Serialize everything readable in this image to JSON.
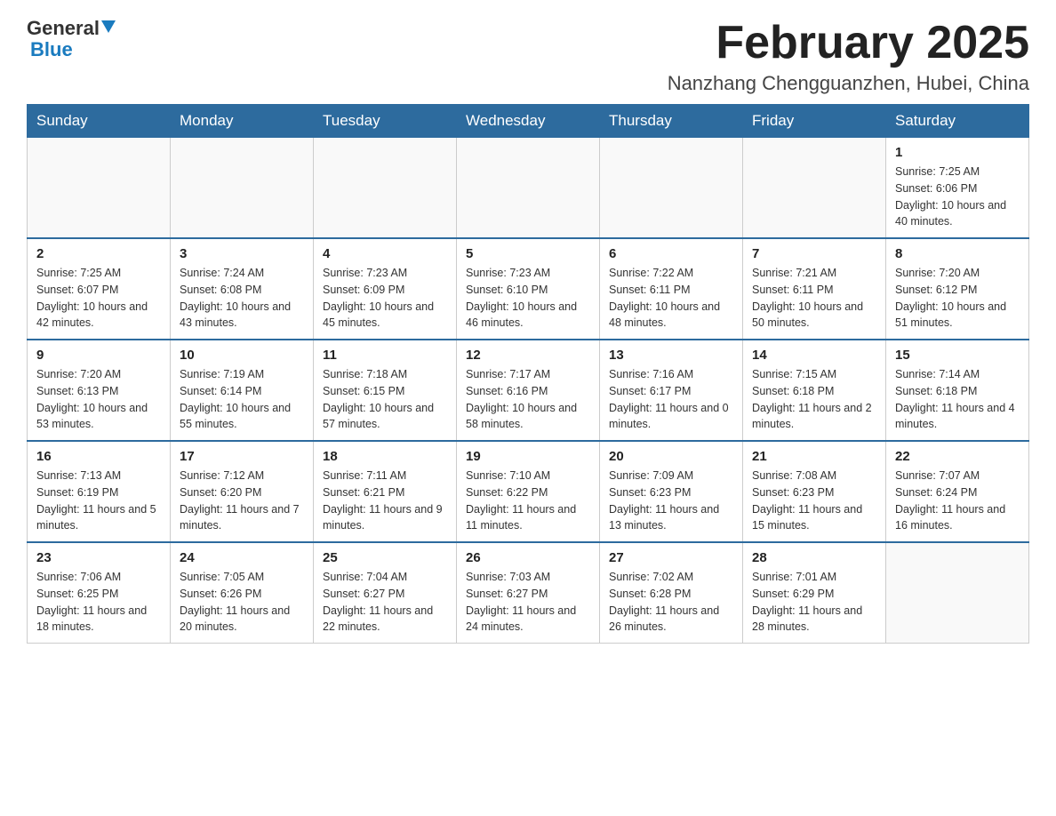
{
  "logo": {
    "part1": "General",
    "part2": "Blue"
  },
  "header": {
    "title": "February 2025",
    "subtitle": "Nanzhang Chengguanzhen, Hubei, China"
  },
  "days_of_week": [
    "Sunday",
    "Monday",
    "Tuesday",
    "Wednesday",
    "Thursday",
    "Friday",
    "Saturday"
  ],
  "weeks": [
    {
      "days": [
        {
          "num": "",
          "info": ""
        },
        {
          "num": "",
          "info": ""
        },
        {
          "num": "",
          "info": ""
        },
        {
          "num": "",
          "info": ""
        },
        {
          "num": "",
          "info": ""
        },
        {
          "num": "",
          "info": ""
        },
        {
          "num": "1",
          "info": "Sunrise: 7:25 AM\nSunset: 6:06 PM\nDaylight: 10 hours and 40 minutes."
        }
      ]
    },
    {
      "days": [
        {
          "num": "2",
          "info": "Sunrise: 7:25 AM\nSunset: 6:07 PM\nDaylight: 10 hours and 42 minutes."
        },
        {
          "num": "3",
          "info": "Sunrise: 7:24 AM\nSunset: 6:08 PM\nDaylight: 10 hours and 43 minutes."
        },
        {
          "num": "4",
          "info": "Sunrise: 7:23 AM\nSunset: 6:09 PM\nDaylight: 10 hours and 45 minutes."
        },
        {
          "num": "5",
          "info": "Sunrise: 7:23 AM\nSunset: 6:10 PM\nDaylight: 10 hours and 46 minutes."
        },
        {
          "num": "6",
          "info": "Sunrise: 7:22 AM\nSunset: 6:11 PM\nDaylight: 10 hours and 48 minutes."
        },
        {
          "num": "7",
          "info": "Sunrise: 7:21 AM\nSunset: 6:11 PM\nDaylight: 10 hours and 50 minutes."
        },
        {
          "num": "8",
          "info": "Sunrise: 7:20 AM\nSunset: 6:12 PM\nDaylight: 10 hours and 51 minutes."
        }
      ]
    },
    {
      "days": [
        {
          "num": "9",
          "info": "Sunrise: 7:20 AM\nSunset: 6:13 PM\nDaylight: 10 hours and 53 minutes."
        },
        {
          "num": "10",
          "info": "Sunrise: 7:19 AM\nSunset: 6:14 PM\nDaylight: 10 hours and 55 minutes."
        },
        {
          "num": "11",
          "info": "Sunrise: 7:18 AM\nSunset: 6:15 PM\nDaylight: 10 hours and 57 minutes."
        },
        {
          "num": "12",
          "info": "Sunrise: 7:17 AM\nSunset: 6:16 PM\nDaylight: 10 hours and 58 minutes."
        },
        {
          "num": "13",
          "info": "Sunrise: 7:16 AM\nSunset: 6:17 PM\nDaylight: 11 hours and 0 minutes."
        },
        {
          "num": "14",
          "info": "Sunrise: 7:15 AM\nSunset: 6:18 PM\nDaylight: 11 hours and 2 minutes."
        },
        {
          "num": "15",
          "info": "Sunrise: 7:14 AM\nSunset: 6:18 PM\nDaylight: 11 hours and 4 minutes."
        }
      ]
    },
    {
      "days": [
        {
          "num": "16",
          "info": "Sunrise: 7:13 AM\nSunset: 6:19 PM\nDaylight: 11 hours and 5 minutes."
        },
        {
          "num": "17",
          "info": "Sunrise: 7:12 AM\nSunset: 6:20 PM\nDaylight: 11 hours and 7 minutes."
        },
        {
          "num": "18",
          "info": "Sunrise: 7:11 AM\nSunset: 6:21 PM\nDaylight: 11 hours and 9 minutes."
        },
        {
          "num": "19",
          "info": "Sunrise: 7:10 AM\nSunset: 6:22 PM\nDaylight: 11 hours and 11 minutes."
        },
        {
          "num": "20",
          "info": "Sunrise: 7:09 AM\nSunset: 6:23 PM\nDaylight: 11 hours and 13 minutes."
        },
        {
          "num": "21",
          "info": "Sunrise: 7:08 AM\nSunset: 6:23 PM\nDaylight: 11 hours and 15 minutes."
        },
        {
          "num": "22",
          "info": "Sunrise: 7:07 AM\nSunset: 6:24 PM\nDaylight: 11 hours and 16 minutes."
        }
      ]
    },
    {
      "days": [
        {
          "num": "23",
          "info": "Sunrise: 7:06 AM\nSunset: 6:25 PM\nDaylight: 11 hours and 18 minutes."
        },
        {
          "num": "24",
          "info": "Sunrise: 7:05 AM\nSunset: 6:26 PM\nDaylight: 11 hours and 20 minutes."
        },
        {
          "num": "25",
          "info": "Sunrise: 7:04 AM\nSunset: 6:27 PM\nDaylight: 11 hours and 22 minutes."
        },
        {
          "num": "26",
          "info": "Sunrise: 7:03 AM\nSunset: 6:27 PM\nDaylight: 11 hours and 24 minutes."
        },
        {
          "num": "27",
          "info": "Sunrise: 7:02 AM\nSunset: 6:28 PM\nDaylight: 11 hours and 26 minutes."
        },
        {
          "num": "28",
          "info": "Sunrise: 7:01 AM\nSunset: 6:29 PM\nDaylight: 11 hours and 28 minutes."
        },
        {
          "num": "",
          "info": ""
        }
      ]
    }
  ]
}
